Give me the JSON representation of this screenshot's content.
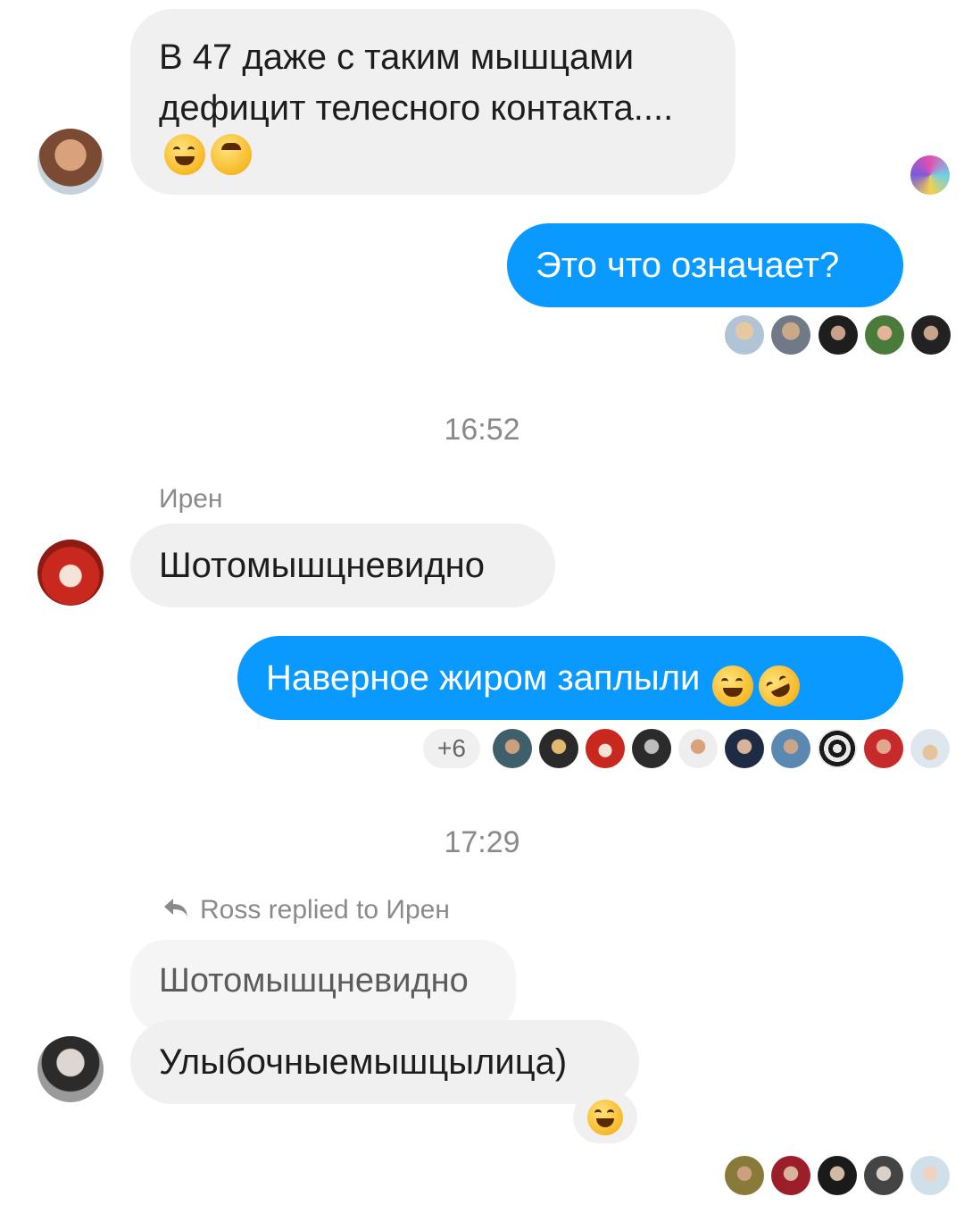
{
  "messages": {
    "m1": {
      "text": "В 47 даже с таким мышцами дефицит телесного контакта....",
      "emojis": [
        "laughing-face-emoji",
        "upside-down-face-emoji"
      ]
    },
    "m2": {
      "text": "Это что означает?"
    },
    "m3": {
      "sender": "Ирен",
      "text": "Шотомышцневидно"
    },
    "m4": {
      "text": "Наверное жиром заплыли",
      "emojis": [
        "tears-of-joy-emoji",
        "rolling-laughing-emoji"
      ]
    },
    "m5": {
      "reply_header": "Ross replied to Ирен",
      "quoted_text": "Шотомышцневидно",
      "text": "Улыбочныемышцылица)",
      "reaction": "laughing-face-emoji"
    }
  },
  "timestamps": {
    "t1": "16:52",
    "t2": "17:29"
  },
  "read_receipts": {
    "extra_count": "+6"
  },
  "colors": {
    "outgoing_bubble": "#0a99ff",
    "incoming_bubble": "#f0f0f0",
    "muted_text": "#8a8a8a"
  }
}
